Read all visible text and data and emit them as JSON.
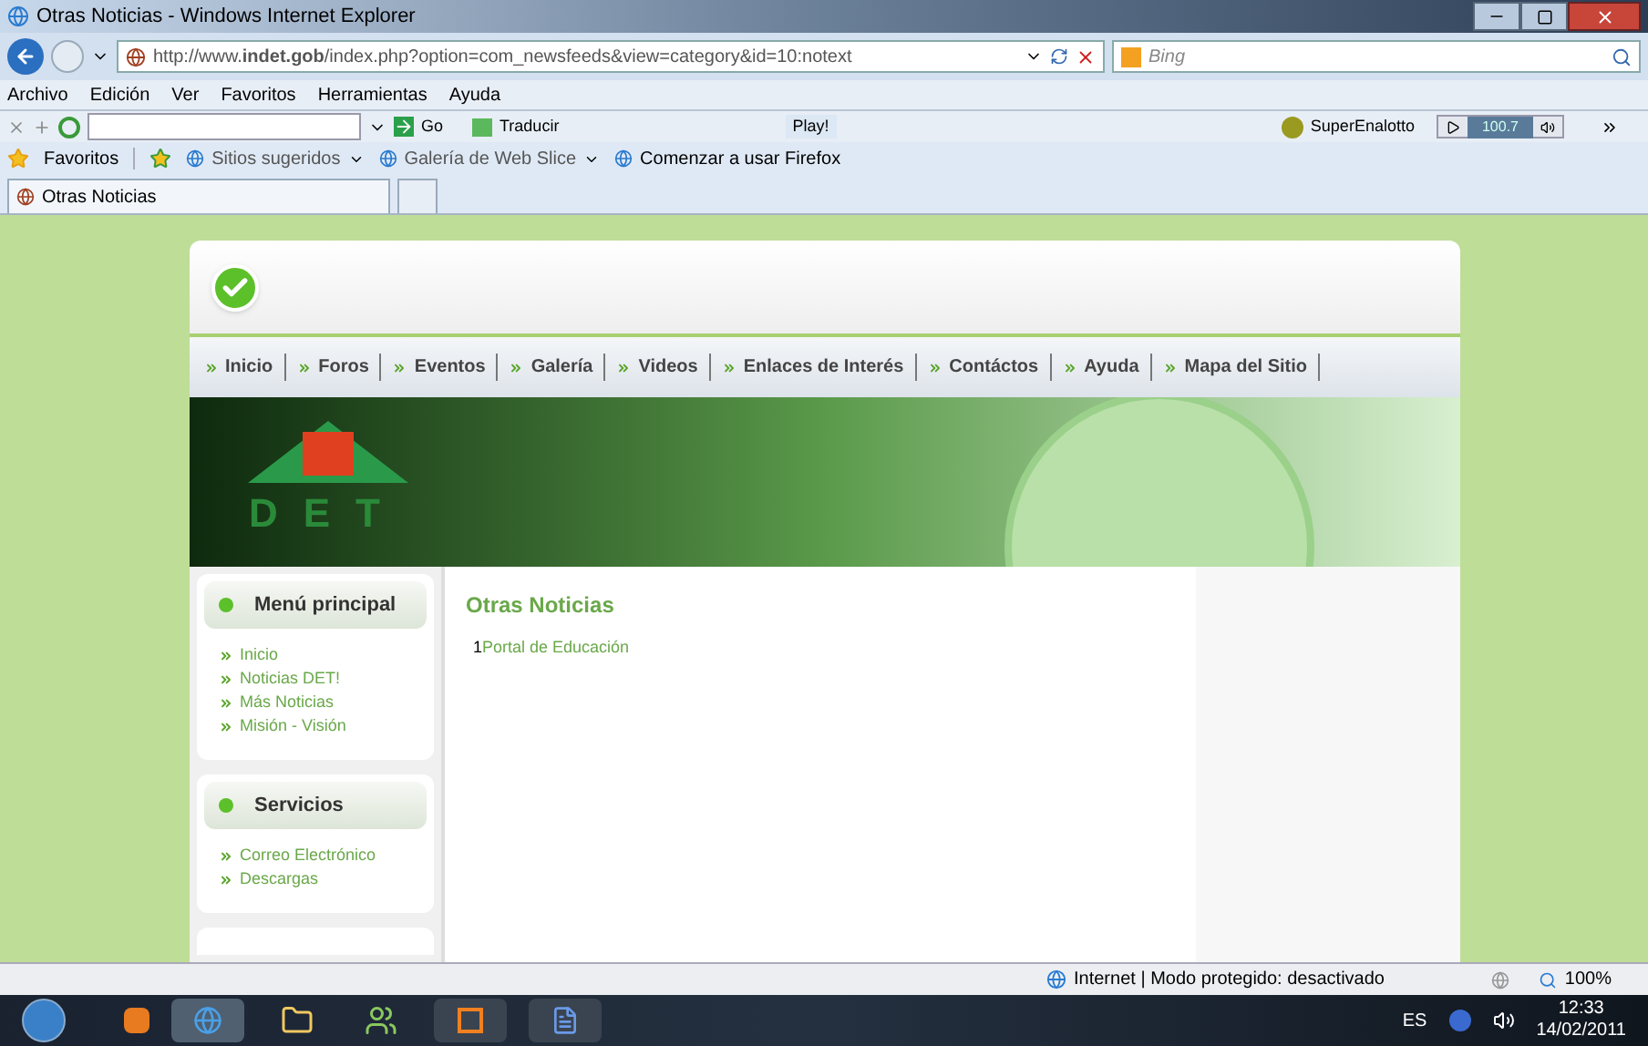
{
  "window": {
    "title": "Otras Noticias - Windows Internet Explorer"
  },
  "address": {
    "url": "http://www.**indet.gob**/index.php?option=com_newsfeeds&view=category&id=10:notext",
    "search_placeholder": "Bing"
  },
  "menu": [
    "Archivo",
    "Edición",
    "Ver",
    "Favoritos",
    "Herramientas",
    "Ayuda"
  ],
  "toolbar": {
    "go": "Go",
    "translate": "Traducir",
    "play": "Play!",
    "lottery": "SuperEnalotto",
    "radio": "100.7"
  },
  "favorites": {
    "label": "Favoritos",
    "items": [
      "Sitios sugeridos",
      "Galería de Web Slice",
      "Comenzar a usar Firefox"
    ]
  },
  "tabs": [
    {
      "label": "Otras Noticias",
      "selected": true
    }
  ],
  "site": {
    "nav": [
      "Inicio",
      "Foros",
      "Eventos",
      "Galería",
      "Videos",
      "Enlaces de Interés",
      "Contáctos",
      "Ayuda",
      "Mapa del Sitio"
    ],
    "logo": "DET",
    "modules": [
      {
        "title": "Menú principal",
        "items": [
          "Inicio",
          "Noticias DET!",
          "Más Noticias",
          "Misión - Visión"
        ]
      },
      {
        "title": "Servicios",
        "items": [
          "Correo Electrónico",
          "Descargas"
        ]
      }
    ],
    "main": {
      "heading": "Otras Noticias",
      "items": [
        {
          "number": "1",
          "link": "Portal de Educación"
        }
      ]
    }
  },
  "status_bar": {
    "text": "Internet | Modo protegido: desactivado",
    "zoom": "100%"
  },
  "taskbar": {
    "language": "ES",
    "time": "12:33",
    "date": "14/02/2011"
  }
}
